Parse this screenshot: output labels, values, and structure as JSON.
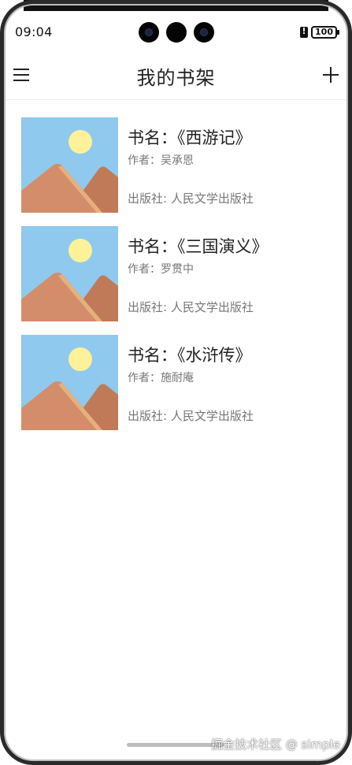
{
  "status_bar": {
    "time": "09:04",
    "battery": "100"
  },
  "header": {
    "title": "我的书架",
    "menu_icon": "menu-icon",
    "add_icon": "plus-icon"
  },
  "books": [
    {
      "name": "书名：《西游记》",
      "author": "作者：吴承恩",
      "publisher": "出版社: 人民文学出版社"
    },
    {
      "name": "书名：《三国演义》",
      "author": "作者：罗贯中",
      "publisher": "出版社: 人民文学出版社"
    },
    {
      "name": "书名：《水浒传》",
      "author": "作者：施耐庵",
      "publisher": "出版社: 人民文学出版社"
    }
  ],
  "watermark": "掘金技术社区 @ simple",
  "colors": {
    "sky": "#8fc9ee",
    "sun": "#fdf29a",
    "mountain_front": "#d48d6a",
    "mountain_back": "#c07a58",
    "mountain_edge": "#e6b07d"
  }
}
